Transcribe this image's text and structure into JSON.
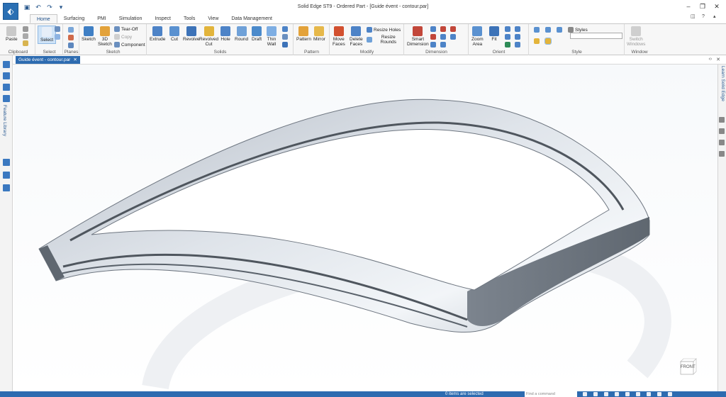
{
  "app": {
    "title": "Solid Edge ST9 - Ordered Part - [Guide évent - contour.par]"
  },
  "ribbon_tabs": [
    "Home",
    "Surfacing",
    "PMI",
    "Simulation",
    "Inspect",
    "Tools",
    "View",
    "Data Management"
  ],
  "groups": {
    "clipboard": {
      "label": "Clipboard",
      "paste": "Paste"
    },
    "select": {
      "label": "Select",
      "select": "Select"
    },
    "planes": {
      "label": "Planes"
    },
    "sketch": {
      "label": "Sketch",
      "sketch": "Sketch",
      "sketch3d": "3D\nSketch",
      "tearoff": "Tear-Off",
      "copy": "Copy",
      "component": "Component"
    },
    "solids": {
      "label": "Solids",
      "extrude": "Extrude",
      "cut": "Cut",
      "revolve": "Revolve",
      "revolved_cut": "Revolved\nCut",
      "hole": "Hole",
      "round": "Round",
      "draft": "Draft",
      "thin_wall": "Thin\nWall"
    },
    "pattern": {
      "label": "Pattern",
      "pattern": "Pattern",
      "mirror": "Mirror"
    },
    "modify": {
      "label": "Modify",
      "move_faces": "Move\nFaces",
      "delete_faces": "Delete\nFaces",
      "resize_holes": "Resize Holes",
      "resize_rounds": "Resize Rounds"
    },
    "dimension": {
      "label": "Dimension",
      "smart_dimension": "Smart\nDimension"
    },
    "orient": {
      "label": "Orient",
      "zoom_area": "Zoom\nArea",
      "fit": "Fit"
    },
    "style": {
      "label": "Style",
      "styles": "Styles"
    },
    "window": {
      "label": "Window",
      "switch_windows": "Switch\nWindows"
    }
  },
  "document_tab": {
    "label": "Guide évent - contour.par"
  },
  "left_panel": {
    "label": "Feature Library"
  },
  "right_panel": {
    "label": "Learn Solid Edge"
  },
  "view_cube": {
    "label": "FRONT"
  },
  "status": {
    "message": "0 items are selected",
    "find_placeholder": "Find a command"
  },
  "colors": {
    "accent": "#2d6bb0",
    "part_light": "#c9d0da",
    "part_dark": "#6e7680"
  }
}
